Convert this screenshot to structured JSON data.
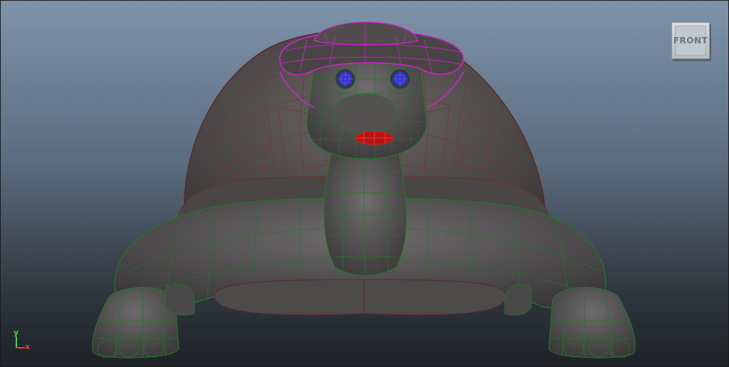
{
  "viewport": {
    "camera_label": "FRONT",
    "background_top": "#7f93a9",
    "background_bottom": "#1e2126"
  },
  "axis": {
    "y_label": "y",
    "x_label": "x",
    "y_color": "#3fdc3f",
    "x_color": "#e83a3a"
  },
  "wireframe_colors": {
    "body": "#1f7a2a",
    "shell": "#6b2f2f",
    "hat": "#d51fd5",
    "eyes": "#2a2ae0",
    "mouth": "#e01818"
  }
}
